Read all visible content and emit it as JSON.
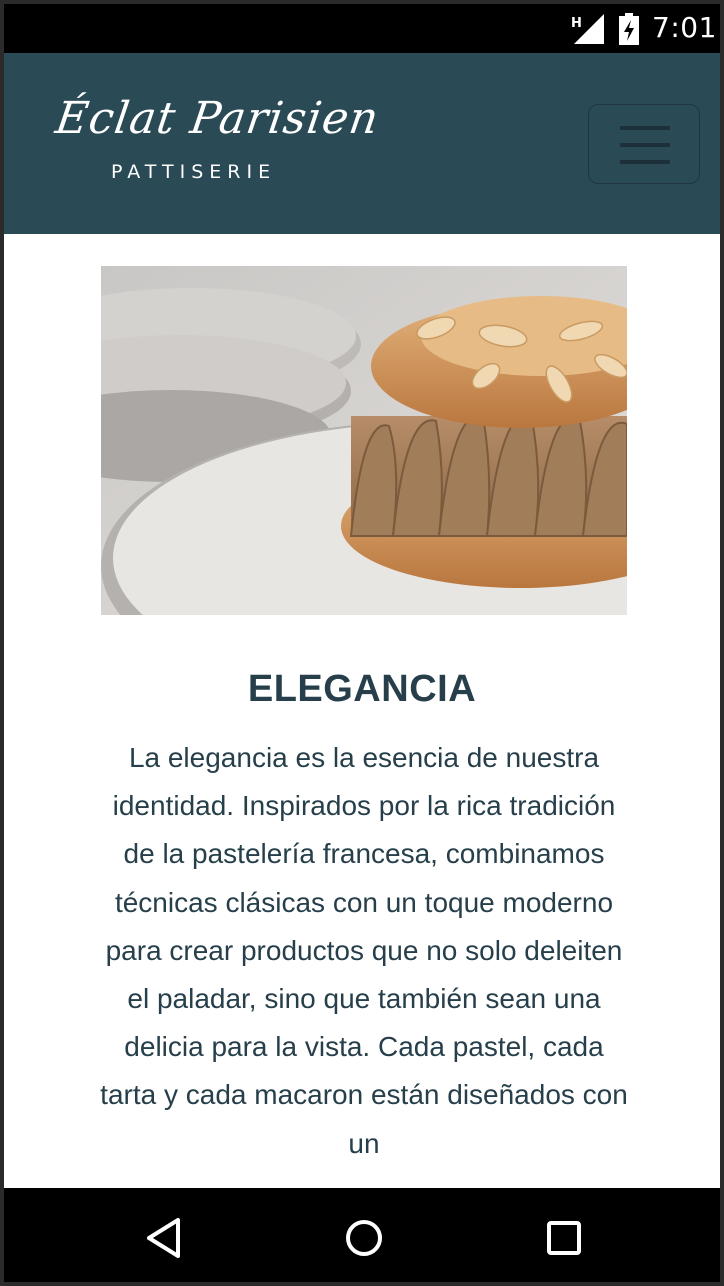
{
  "status_bar": {
    "network_badge": "H",
    "time": "7:01"
  },
  "header": {
    "logo_script": "Éclat Parisien",
    "logo_subtitle": "PATTISERIE",
    "menu_icon": "hamburger-icon"
  },
  "main": {
    "hero_image": "paris-brest-pastry-photo",
    "section_title": "ELEGANCIA",
    "section_body": "La elegancia es la esencia de nuestra identidad. Inspirados por la rica tradición de la pastelería francesa, combinamos técnicas clásicas con un toque moderno para crear productos que no solo deleiten el paladar, sino que también sean una delicia para la vista. Cada pastel, cada tarta y cada macaron están diseñados con un"
  },
  "nav_bar": {
    "back_icon": "back-triangle-icon",
    "home_icon": "home-circle-icon",
    "recents_icon": "recents-square-icon"
  },
  "colors": {
    "header_bg": "#2a4a55",
    "text": "#263f4a",
    "system_bars": "#000000"
  }
}
